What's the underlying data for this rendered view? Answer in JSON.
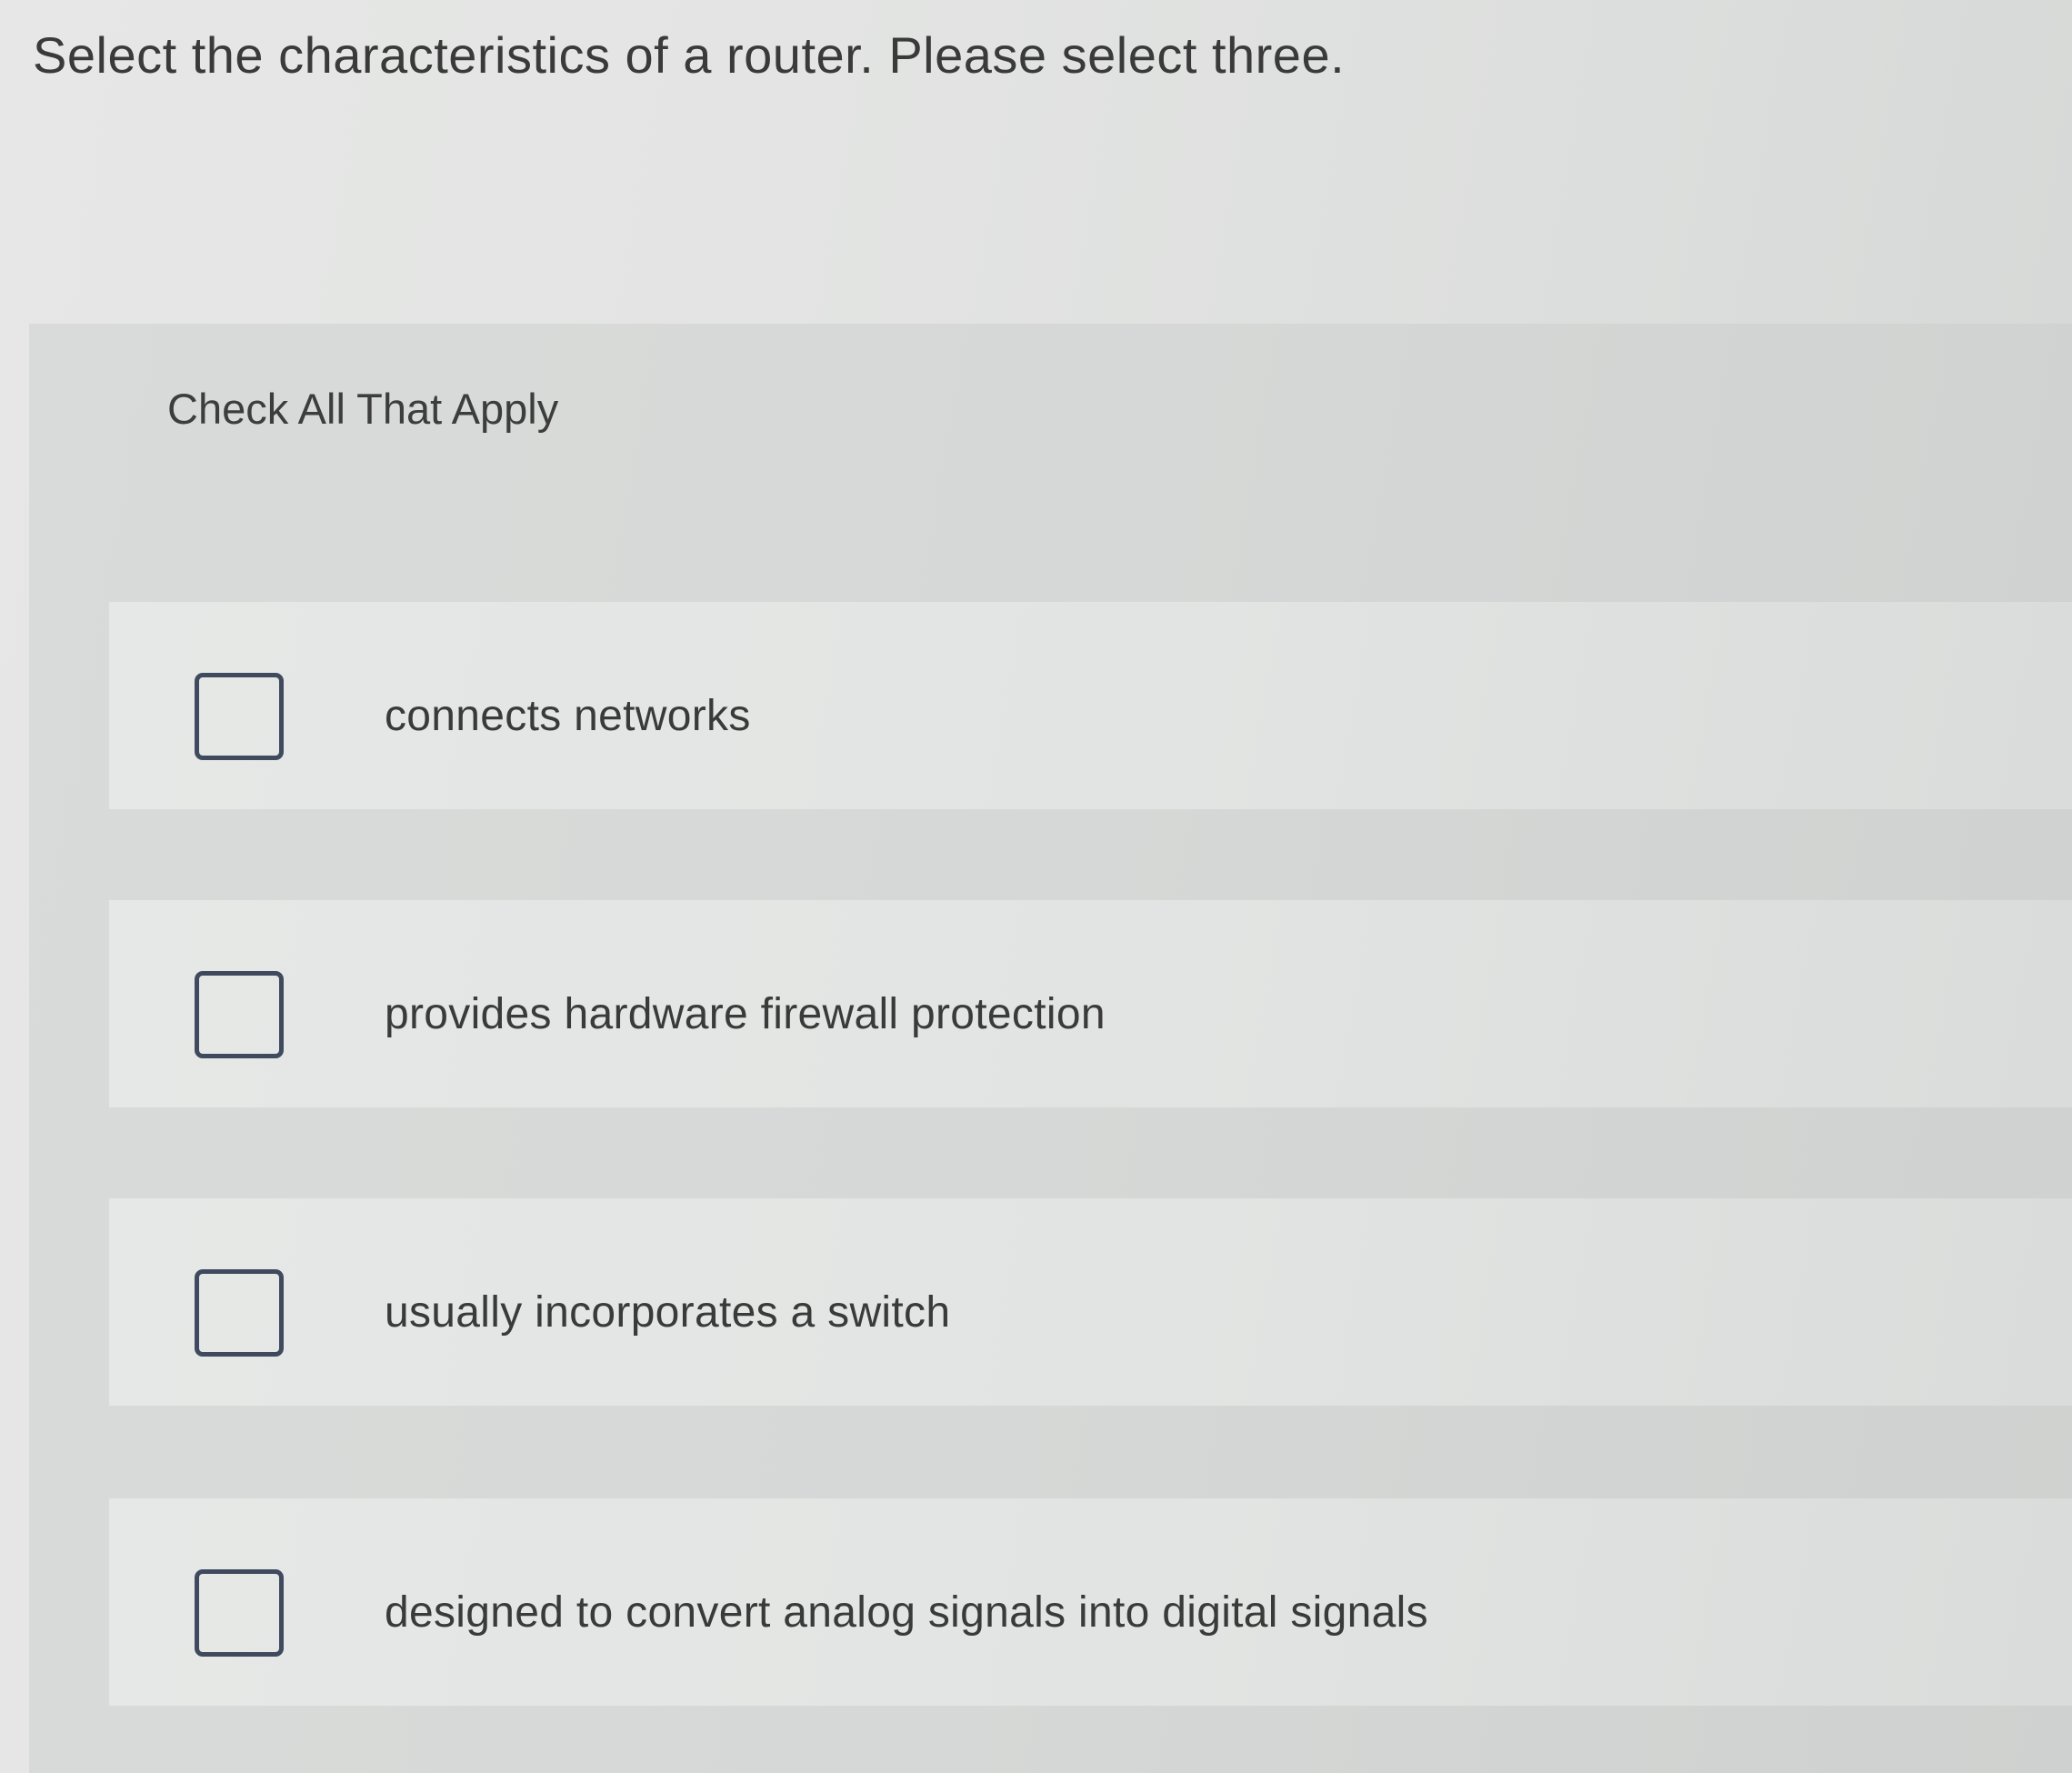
{
  "question": {
    "text": "Select the characteristics of a router. Please select three."
  },
  "panel": {
    "instruction": "Check All That Apply",
    "options": [
      {
        "label": "connects networks",
        "checked": false
      },
      {
        "label": "provides hardware firewall protection",
        "checked": false
      },
      {
        "label": "usually incorporates a switch",
        "checked": false
      },
      {
        "label": "designed to convert analog signals into digital signals",
        "checked": false
      }
    ]
  },
  "colors": {
    "checkbox_border": "#3f4a5e",
    "text": "#3a3a3a"
  }
}
